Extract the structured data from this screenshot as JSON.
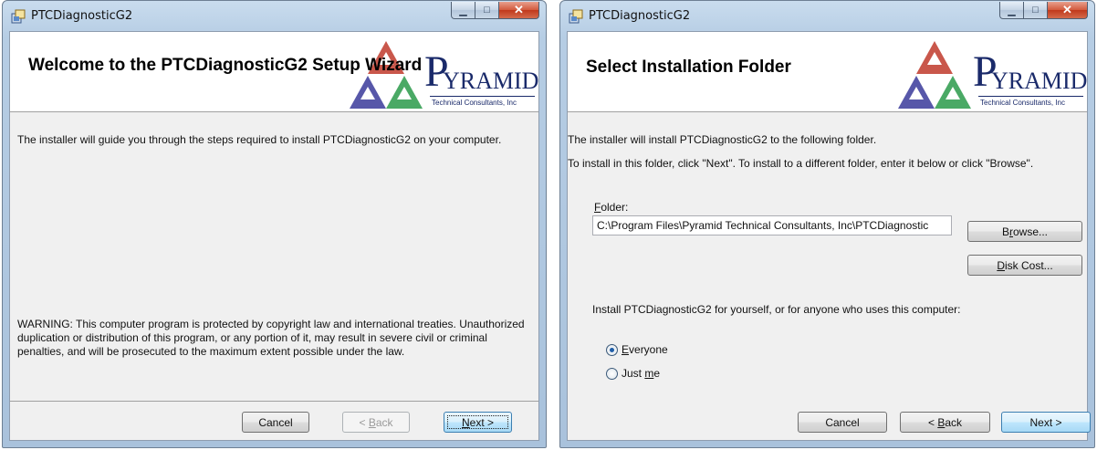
{
  "colors": {
    "title_bar": "#b6cde4",
    "close_button": "#c0391c",
    "client": "#f0f0f0",
    "logo": "#1a2a6a"
  },
  "icons": {
    "app": "installer-icon",
    "logo": "pyramid-logo"
  },
  "logo": {
    "initial": "P",
    "name": "YRAMID",
    "tagline": "Technical Consultants, Inc"
  },
  "window1": {
    "title": "PTCDiagnosticG2",
    "banner_title": "Welcome to the PTCDiagnosticG2 Setup Wizard",
    "intro": "The installer will guide you through the steps required to install PTCDiagnosticG2 on your computer.",
    "warning": "WARNING: This computer program is protected by copyright law and international treaties. Unauthorized duplication or distribution of this program, or any portion of it, may result in severe civil or criminal penalties, and will be prosecuted to the maximum extent possible under the law.",
    "buttons": {
      "cancel": "Cancel",
      "back": {
        "prefix": "< ",
        "mnemonic": "B",
        "rest": "ack"
      },
      "next": {
        "mnemonic": "N",
        "rest": "ext >"
      }
    }
  },
  "window2": {
    "title": "PTCDiagnosticG2",
    "banner_title": "Select Installation Folder",
    "line1": "The installer will install PTCDiagnosticG2 to the following folder.",
    "line2": "To install in this folder, click \"Next\". To install to a different folder, enter it below or click \"Browse\".",
    "folder_label": {
      "mnemonic": "F",
      "rest": "older:"
    },
    "folder_value": "C:\\Program Files\\Pyramid Technical Consultants, Inc\\PTCDiagnostic",
    "browse": {
      "prefix": "B",
      "mnemonic": "r",
      "rest": "owse..."
    },
    "disk_cost": {
      "mnemonic": "D",
      "rest": "isk Cost..."
    },
    "install_for": "Install PTCDiagnosticG2 for yourself, or for anyone who uses this computer:",
    "options": [
      {
        "mnemonic": "E",
        "rest": "veryone",
        "selected": true
      },
      {
        "prefix": "Just ",
        "mnemonic": "m",
        "rest": "e",
        "selected": false
      }
    ],
    "buttons": {
      "cancel": "Cancel",
      "back": {
        "prefix": "< ",
        "mnemonic": "B",
        "rest": "ack"
      },
      "next": "Next >"
    }
  }
}
